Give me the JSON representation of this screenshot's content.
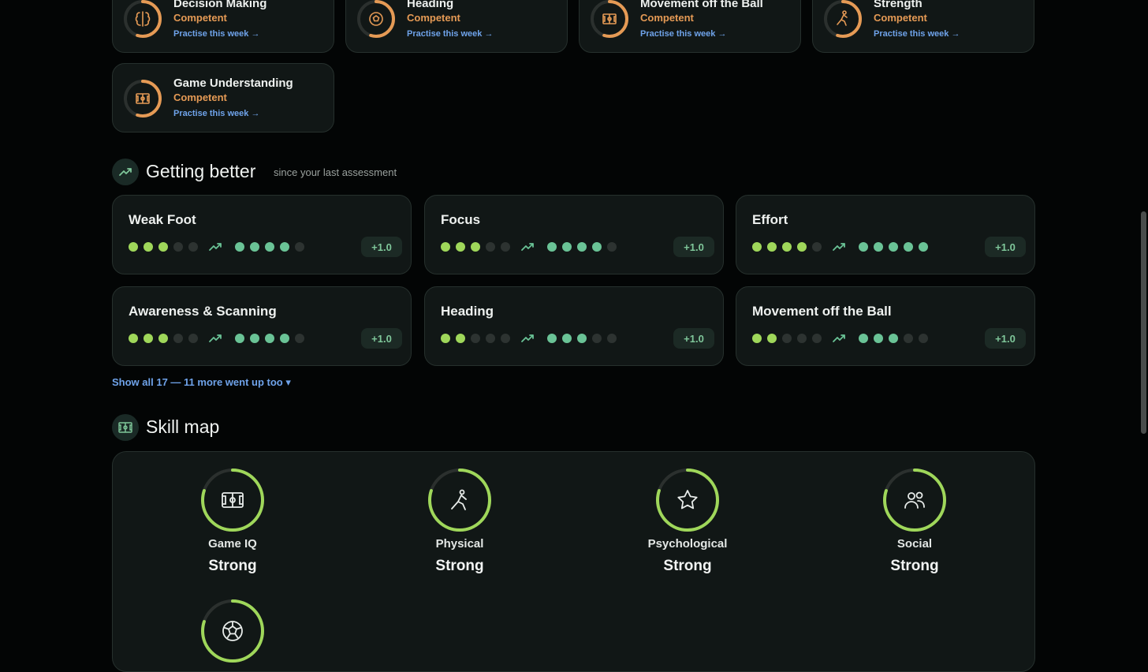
{
  "focus_cards": [
    {
      "title": "Decision Making",
      "level": "Competent",
      "link": "Practise this week →",
      "icon": "brain-icon"
    },
    {
      "title": "Heading",
      "level": "Competent",
      "link": "Practise this week →",
      "icon": "football-icon"
    },
    {
      "title": "Movement off the Ball",
      "level": "Competent",
      "link": "Practise this week →",
      "icon": "pitch-icon"
    },
    {
      "title": "Strength",
      "level": "Competent",
      "link": "Practise this week →",
      "icon": "runner-icon"
    },
    {
      "title": "Game Understanding",
      "level": "Competent",
      "link": "Practise this week →",
      "icon": "pitch-icon"
    }
  ],
  "getting_better": {
    "title": "Getting better",
    "subtitle": "since your last assessment",
    "icon": "trend-up-icon",
    "items": [
      {
        "name": "Weak Foot",
        "before": 3,
        "after": 4,
        "delta": "+1.0"
      },
      {
        "name": "Focus",
        "before": 3,
        "after": 4,
        "delta": "+1.0"
      },
      {
        "name": "Effort",
        "before": 4,
        "after": 5,
        "delta": "+1.0"
      },
      {
        "name": "Awareness & Scanning",
        "before": 3,
        "after": 4,
        "delta": "+1.0"
      },
      {
        "name": "Heading",
        "before": 2,
        "after": 3,
        "delta": "+1.0"
      },
      {
        "name": "Movement off the Ball",
        "before": 2,
        "after": 3,
        "delta": "+1.0"
      }
    ],
    "show_all": "Show all 17 — 11 more went up too ▾"
  },
  "skill_map": {
    "title": "Skill map",
    "icon": "pitch-icon",
    "skills": [
      {
        "name": "Game IQ",
        "level": "Strong",
        "icon": "pitch-icon",
        "fill": 0.8
      },
      {
        "name": "Physical",
        "level": "Strong",
        "icon": "runner-icon",
        "fill": 0.8
      },
      {
        "name": "Psychological",
        "level": "Strong",
        "icon": "star-icon",
        "fill": 0.8
      },
      {
        "name": "Social",
        "level": "Strong",
        "icon": "people-icon",
        "fill": 0.8
      },
      {
        "name": "",
        "level": "",
        "icon": "football-icon",
        "fill": 0.8
      }
    ]
  },
  "colors": {
    "competent": "#e59a55",
    "link": "#6fa3ea",
    "lime": "#9fd75a",
    "mint": "#6ac396",
    "background": "#030505"
  }
}
